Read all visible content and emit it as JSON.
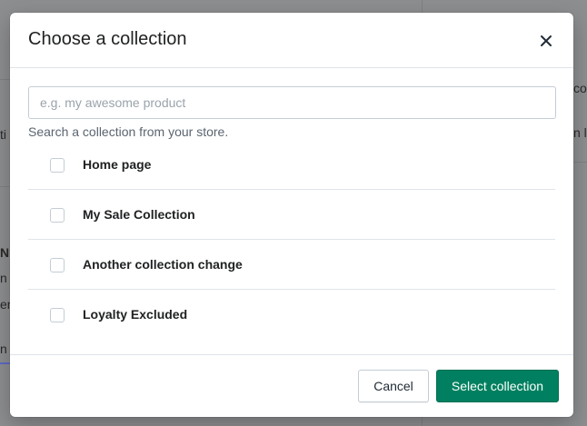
{
  "background": {
    "fragments": [
      "co",
      "n l",
      "N",
      "n t",
      "en",
      "n",
      "ti"
    ]
  },
  "modal": {
    "title": "Choose a collection",
    "close_icon": "close-icon",
    "search": {
      "placeholder": "e.g. my awesome product",
      "value": "",
      "help_text": "Search a collection from your store."
    },
    "collections": [
      {
        "label": "Home page",
        "checked": false
      },
      {
        "label": "My Sale Collection",
        "checked": false
      },
      {
        "label": "Another collection change",
        "checked": false
      },
      {
        "label": "Loyalty Excluded",
        "checked": false
      }
    ],
    "footer": {
      "cancel_label": "Cancel",
      "primary_label": "Select collection"
    }
  },
  "colors": {
    "primary": "#008060",
    "overlay": "#8f8f91",
    "border": "#dfe3e8"
  }
}
